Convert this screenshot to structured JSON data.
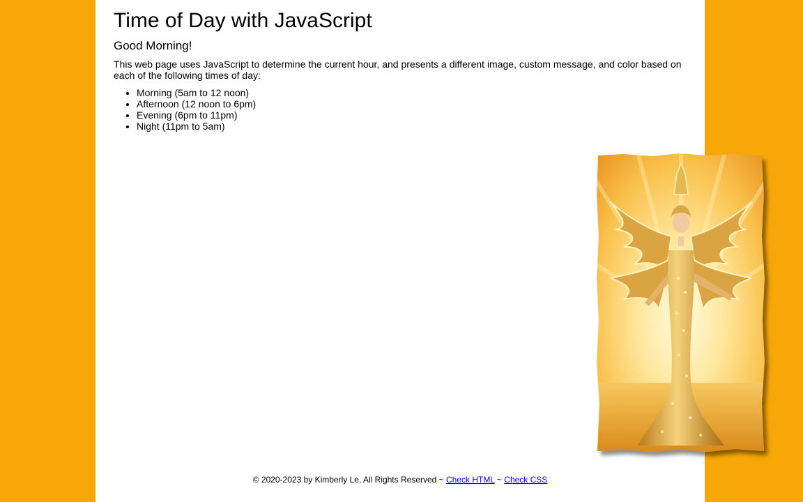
{
  "header": {
    "title": "Time of Day with JavaScript",
    "greeting": "Good Morning!"
  },
  "main": {
    "intro": "This web page uses JavaScript to determine the current hour, and presents a different image, custom message, and color based on each of the following times of day:",
    "times": [
      "Morning (5am to 12 noon)",
      "Afternoon (12 noon to 6pm)",
      "Evening (6pm to 11pm)",
      "Night (11pm to 5am)"
    ],
    "image": {
      "icon": "golden-figure-photo"
    }
  },
  "footer": {
    "copyright": "© 2020-2023 by Kimberly Le, All Rights Reserved ~ ",
    "separator": " ~ ",
    "check_html": "Check HTML",
    "check_css": "Check CSS"
  },
  "colors": {
    "background": "#F7A707",
    "page": "#FFFFFF",
    "link": "#0000EE"
  }
}
